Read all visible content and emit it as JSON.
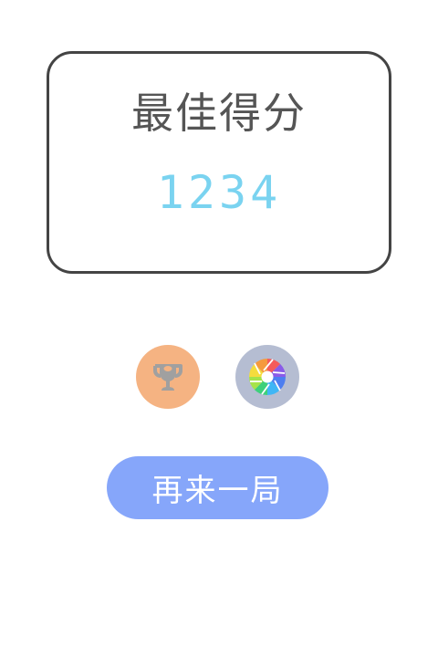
{
  "score_card": {
    "title": "最佳得分",
    "best_score": "1234"
  },
  "actions": {
    "leaderboard_icon": "trophy-icon",
    "share_icon": "camera-aperture-icon",
    "retry_label": "再来一局"
  },
  "colors": {
    "score_text": "#7ad3f0",
    "title_text": "#555555",
    "card_border": "#444444",
    "leaderboard_bg": "#f5b382",
    "share_bg": "#b5bdd2",
    "retry_bg": "#86a6fa"
  }
}
